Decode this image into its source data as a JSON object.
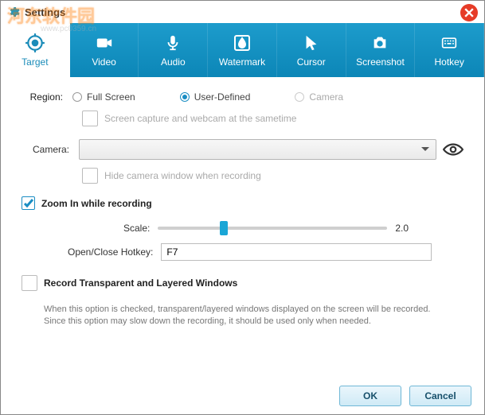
{
  "window": {
    "title": "Settings"
  },
  "watermark": {
    "text": "河东软件园",
    "url": "www.pc0359.cn"
  },
  "tabs": {
    "target": "Target",
    "video": "Video",
    "audio": "Audio",
    "watermark": "Watermark",
    "cursor": "Cursor",
    "screenshot": "Screenshot",
    "hotkey": "Hotkey"
  },
  "region": {
    "label": "Region:",
    "full_screen": "Full Screen",
    "user_defined": "User-Defined",
    "camera": "Camera",
    "selected": "user_defined",
    "sametime_label": "Screen capture and webcam at the sametime"
  },
  "camera": {
    "label": "Camera:",
    "selected": "",
    "hide_label": "Hide camera window when recording"
  },
  "zoom": {
    "label": "Zoom In while recording",
    "checked": true,
    "scale_label": "Scale:",
    "scale_value": "2.0",
    "hotkey_label": "Open/Close Hotkey:",
    "hotkey_value": "F7"
  },
  "transparent": {
    "label": "Record Transparent and Layered Windows",
    "checked": false,
    "desc1": "When this option is checked, transparent/layered windows displayed on the screen will be recorded.",
    "desc2": "Since this option may slow down the recording, it should be used only when needed."
  },
  "buttons": {
    "ok": "OK",
    "cancel": "Cancel"
  }
}
